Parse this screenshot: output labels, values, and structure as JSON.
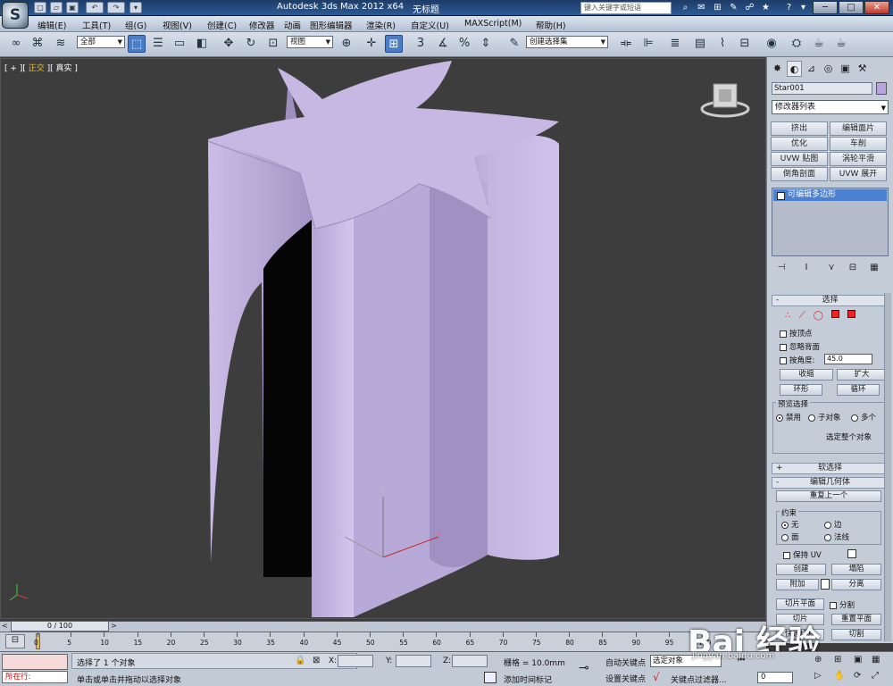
{
  "app": {
    "logo": "S",
    "title": "Autodesk 3ds Max  2012 x64",
    "doc_title": "无标题",
    "search_placeholder": "键入关键字或短语",
    "window_buttons": [
      "─",
      "□",
      "✕"
    ]
  },
  "menu": [
    "编辑(E)",
    "工具(T)",
    "组(G)",
    "视图(V)",
    "创建(C)",
    "修改器",
    "动画",
    "图形编辑器",
    "渲染(R)",
    "自定义(U)",
    "MAXScript(M)",
    "帮助(H)"
  ],
  "toolbar": {
    "filter_select": "全部",
    "ref_coord": "视图",
    "snap_label": "3",
    "angle_snap": "%",
    "named_selection": "创建选择集"
  },
  "viewport": {
    "label_bracket_open": "[",
    "label_plus": "+",
    "label_sep1": "][",
    "label_view": "正交",
    "label_sep2": "][",
    "label_shading": "真实",
    "label_bracket_close": "]",
    "object_color": "#b7a7d8",
    "gizmo_axes": {
      "x": "x",
      "y": "y",
      "z": "z"
    }
  },
  "command_panel": {
    "object_name": "Star001",
    "object_color": "#b8a2e0",
    "modifier_list": "修改器列表",
    "modifier_buttons": [
      [
        "挤出",
        "编辑面片"
      ],
      [
        "优化",
        "车削"
      ],
      [
        "UVW 贴图",
        "涡轮平滑"
      ],
      [
        "倒角剖面",
        "UVW 展开"
      ]
    ],
    "stack_item": "可编辑多边形",
    "selection": {
      "header_sign": "-",
      "header": "选择",
      "by_vertex": "按顶点",
      "ignore_backface": "忽略背面",
      "by_angle": "按角度:",
      "angle_value": "45.0",
      "shrink": "收缩",
      "grow": "扩大",
      "ring": "环形",
      "loop": "循环",
      "preview_title": "预览选择",
      "preview_options": [
        "禁用",
        "子对象",
        "多个"
      ],
      "info": "选定整个对象"
    },
    "soft_selection": {
      "sign": "+",
      "header": "软选择"
    },
    "edit_geometry": {
      "sign": "-",
      "header": "编辑几何体",
      "repeat_last": "重复上一个",
      "constraints_title": "约束",
      "constraints": [
        "无",
        "边",
        "面",
        "法线"
      ],
      "preserve_uv": "保持 UV",
      "create": "创建",
      "collapse": "塌陷",
      "attach": "附加",
      "detach": "分离",
      "slice_plane": "切片平面",
      "split": "分割",
      "slice": "切片",
      "reset_plane": "重置平面",
      "quickslice": "快速切片",
      "cut": "切割"
    }
  },
  "timeline": {
    "slider": "0 / 100",
    "ticks": [
      "0",
      "5",
      "10",
      "15",
      "20",
      "25",
      "30",
      "35",
      "40",
      "45",
      "50",
      "55",
      "60",
      "65",
      "70",
      "75",
      "80",
      "85",
      "90",
      "95",
      "100"
    ]
  },
  "status": {
    "running": "所在行:",
    "selected": "选择了 1 个对象",
    "hint": "单击或单击并拖动以选择对象",
    "x_label": "X:",
    "y_label": "Y:",
    "z_label": "Z:",
    "grid": "栅格 = 10.0mm",
    "add_time_tag": "添加时间标记",
    "auto_key": "自动关键点",
    "set_key": "设置关键点",
    "selected_object": "选定对象",
    "key_filters": "关键点过滤器...",
    "frame": "0"
  },
  "watermark": {
    "text": "Bai 经验",
    "url": "jingyan.baidu.com"
  }
}
